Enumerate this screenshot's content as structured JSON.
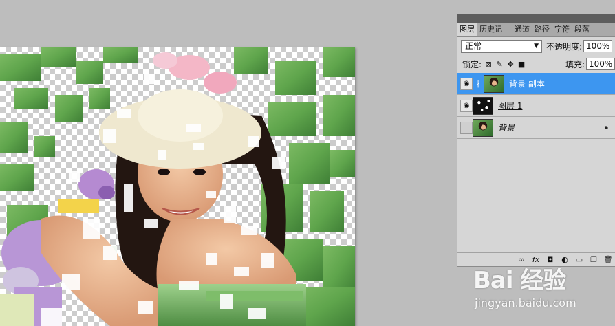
{
  "panel": {
    "tabs": [
      "图层",
      "历史记",
      "通道",
      "路径",
      "字符",
      "段落"
    ],
    "blend_mode": "正常",
    "opacity_label": "不透明度:",
    "opacity_value": "100%",
    "lock_label": "锁定:",
    "fill_label": "填充:",
    "fill_value": "100%",
    "layers": [
      {
        "name": "背景 副本",
        "visible": true,
        "selected": true
      },
      {
        "name": "图层 1",
        "visible": true,
        "selected": false
      },
      {
        "name": "背景",
        "visible": false,
        "selected": false,
        "locked": true
      }
    ]
  },
  "watermark": {
    "logo": "Bai 经验",
    "url": "jingyan.baidu.com"
  },
  "colors": {
    "selection": "#3d96f0",
    "panel_bg": "#d6d6d6",
    "workspace_bg": "#bdbdbd"
  }
}
